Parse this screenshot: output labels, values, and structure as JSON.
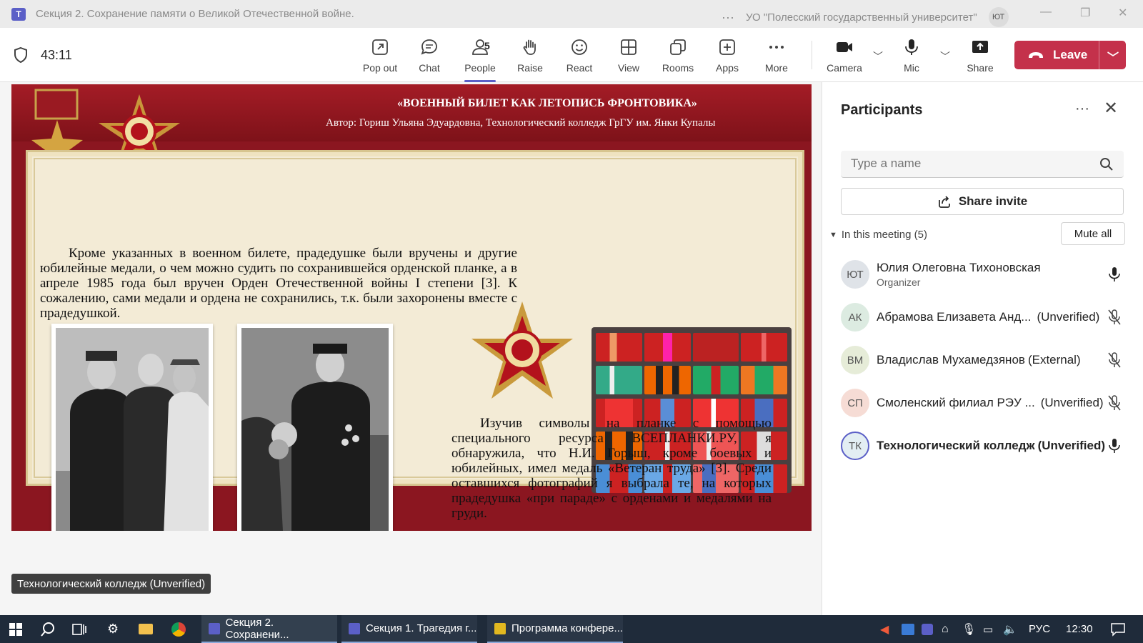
{
  "window": {
    "title": "Секция 2. Сохранение памяти о Великой Отечественной войне.",
    "org": "УО \"Полесский государственный университет\"",
    "user_initials": "ЮТ"
  },
  "toolbar": {
    "timer": "43:11",
    "buttons": [
      {
        "label": "Pop out",
        "icon": "pop-out-icon"
      },
      {
        "label": "Chat",
        "icon": "chat-icon"
      },
      {
        "label": "People",
        "icon": "people-icon",
        "count": "5"
      },
      {
        "label": "Raise",
        "icon": "raise-hand-icon"
      },
      {
        "label": "React",
        "icon": "smile-icon"
      },
      {
        "label": "View",
        "icon": "grid-view-icon"
      },
      {
        "label": "Rooms",
        "icon": "rooms-icon"
      },
      {
        "label": "Apps",
        "icon": "apps-icon"
      },
      {
        "label": "More",
        "icon": "more-icon"
      }
    ],
    "camera_label": "Camera",
    "mic_label": "Mic",
    "share_label": "Share",
    "leave_label": "Leave"
  },
  "slide": {
    "title": "«ВОЕННЫЙ БИЛЕТ КАК ЛЕТОПИСЬ ФРОНТОВИКА»",
    "author": "Автор: Гориш Ульяна Эдуардовна, Технологический колледж ГрГУ им. Янки Купалы",
    "paragraph1": "Кроме указанных в военном билете, прадедушке были вручены и другие юбилейные медали, о чем можно судить по сохранившейся орденской планке, а в апреле 1985 года был вручен Орден Отечественной войны I степени [3]. К сожалению, сами медали и ордена не сохранились, т.к. были захоронены вместе с прадедушкой.",
    "paragraph2": "Изучив символы на планке с помощью специального ресурса ВСЕПЛАНКИ.РУ, я обнаружила, что Н.И. Горыш, кроме боевых и юбилейных, имел медаль «Ветеран труда» [3]. Среди оставшихся фотографий я выбрала те, на которых прадедушка «при параде» с орденами и медалями на груди.",
    "speaker_tag": "Технологический колледж (Unverified)"
  },
  "participants": {
    "title": "Participants",
    "search_placeholder": "Type a name",
    "share_invite": "Share invite",
    "group_label": "In this meeting (5)",
    "mute_all": "Mute all",
    "list": [
      {
        "initials": "ЮТ",
        "name": "Юлия Олеговна Тихоновская",
        "role": "Organizer",
        "tag": "",
        "mic": "on",
        "color": "#dfe3e8"
      },
      {
        "initials": "АК",
        "name": "Абрамова Елизавета Анд...",
        "role": "",
        "tag": "(Unverified)",
        "mic": "muted",
        "color": "#dcebe1"
      },
      {
        "initials": "ВМ",
        "name": "Владислав Мухамедзянов",
        "role": "",
        "tag": "(External)",
        "mic": "muted",
        "color": "#e6ecd8"
      },
      {
        "initials": "СП",
        "name": "Смоленский филиал РЭУ ...",
        "role": "",
        "tag": "(Unverified)",
        "mic": "muted",
        "color": "#f6dcd5"
      },
      {
        "initials": "ТК",
        "name": "Технологический колледж",
        "role": "",
        "tag": "(Unverified)",
        "mic": "on",
        "color": "#e3eef3"
      }
    ]
  },
  "taskbar": {
    "apps": [
      {
        "label": "Секция 2. Сохранени...",
        "icon": "teams-icon"
      },
      {
        "label": "Секция 1. Трагедия г...",
        "icon": "teams-icon"
      },
      {
        "label": "Программа конфере...",
        "icon": "document-icon"
      }
    ],
    "lang": "РУС",
    "time": "12:30"
  }
}
